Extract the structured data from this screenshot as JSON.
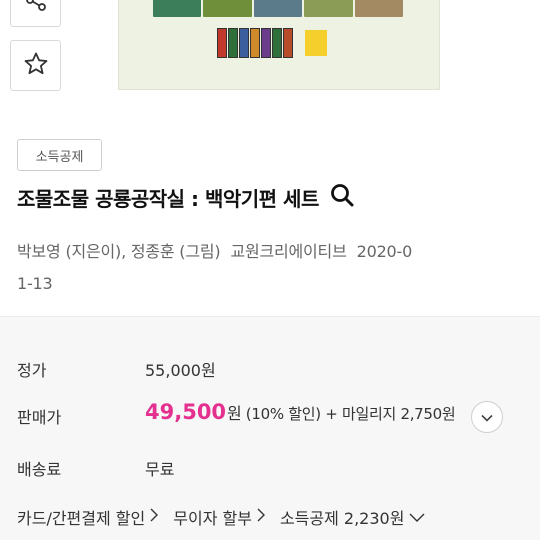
{
  "sidebar_actions": {
    "share_icon": "share-icon",
    "wish_icon": "star-icon"
  },
  "product": {
    "badge": "소득공제",
    "title": "조물조물 공룡공작실 : 백악기편 세트",
    "search_icon": "search-icon",
    "author": "박보영 (지은이), 정종훈 (그림)",
    "publisher": "교원크리에이티브",
    "date_part1": "2020-0",
    "date_part2": "1-13"
  },
  "price": {
    "list_label": "정가",
    "list_value": "55,000원",
    "sale_label": "판매가",
    "sale_number": "49,500",
    "sale_unit": "원",
    "sale_extra": "(10% 할인) + 마일리지 2,750원",
    "shipping_label": "배송료",
    "shipping_value": "무료"
  },
  "discounts": [
    {
      "label": "카드/간편결제 할인",
      "icon": "chevron-right-icon"
    },
    {
      "label": "무이자 할부",
      "icon": "chevron-right-icon"
    },
    {
      "label": "소득공제 2,230원",
      "icon": "chevron-down-icon"
    }
  ],
  "colors": {
    "accent": "#e4308f",
    "image_bg": "#eef2e2",
    "price_bg": "#f7f7f7"
  }
}
